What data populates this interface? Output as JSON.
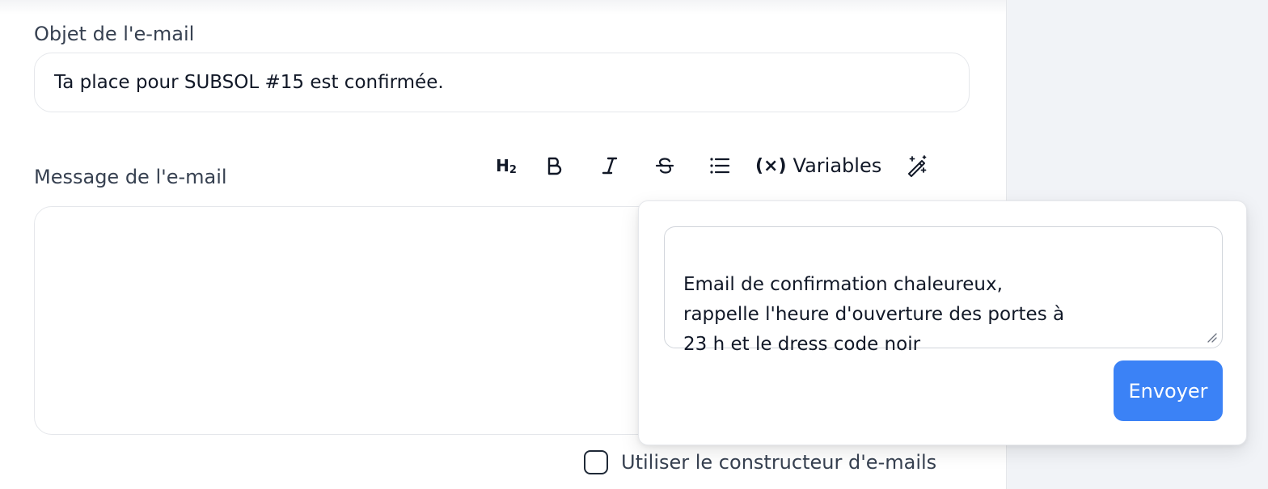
{
  "form": {
    "subject_label": "Objet de l'e-mail",
    "subject_value": "Ta place pour SUBSOL #15 est confirmée.",
    "message_label": "Message de l'e-mail",
    "builder_label": "Utiliser le constructeur d'e-mails",
    "builder_checked": false
  },
  "toolbar": {
    "heading_icon": "heading-2-icon",
    "heading_label": "H",
    "heading_sub": "2",
    "bold_icon": "bold-icon",
    "italic_icon": "italic-icon",
    "strike_icon": "strikethrough-icon",
    "list_icon": "bullet-list-icon",
    "variables_icon": "variable-icon",
    "variables_glyph": "(×)",
    "variables_label": "Variables",
    "magic_icon": "magic-wand-icon"
  },
  "ai_popover": {
    "prompt_text": "Email de confirmation chaleureux,\nrappelle l'heure d'ouverture des portes à\n23 h et le dress code noir",
    "send_label": "Envoyer",
    "accent": "#3b82f6"
  }
}
